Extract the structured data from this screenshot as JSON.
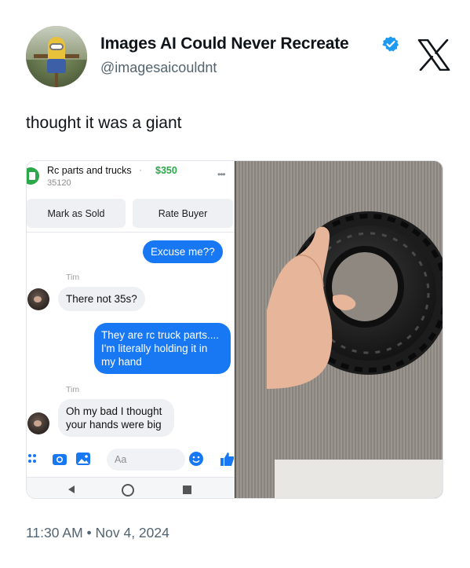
{
  "tweet": {
    "author_name": "Images AI Could Never Recreate",
    "author_handle": "@imagesaicouldnt",
    "text": "thought it was a giant",
    "timestamp": "11:30 AM • Nov 4, 2024",
    "verified_color": "#1d9bf0"
  },
  "messenger": {
    "listing_title": "Rc parts and trucks",
    "listing_price": "$350",
    "listing_location": "35120",
    "separator": "·",
    "more_label": "•••",
    "mark_sold_label": "Mark as Sold",
    "rate_buyer_label": "Rate Buyer",
    "composer_placeholder": "Aa",
    "accent_color": "#1877f2",
    "price_color": "#2aa84a",
    "messages": [
      {
        "from": "me",
        "text": "Excuse me??"
      },
      {
        "from": "Tim",
        "sender_label": "Tim",
        "text": "There not 35s?"
      },
      {
        "from": "me",
        "text": "They are rc truck parts.... I'm literally holding it in my hand"
      },
      {
        "from": "Tim",
        "sender_label": "Tim",
        "text": "Oh my bad I thought your hands were big"
      }
    ]
  },
  "icons": [
    "verified-badge-icon",
    "x-logo-icon",
    "apps-icon",
    "camera-icon",
    "gallery-icon",
    "emoji-icon",
    "thumbs-up-icon",
    "back-nav-icon",
    "home-nav-icon",
    "recents-nav-icon"
  ]
}
